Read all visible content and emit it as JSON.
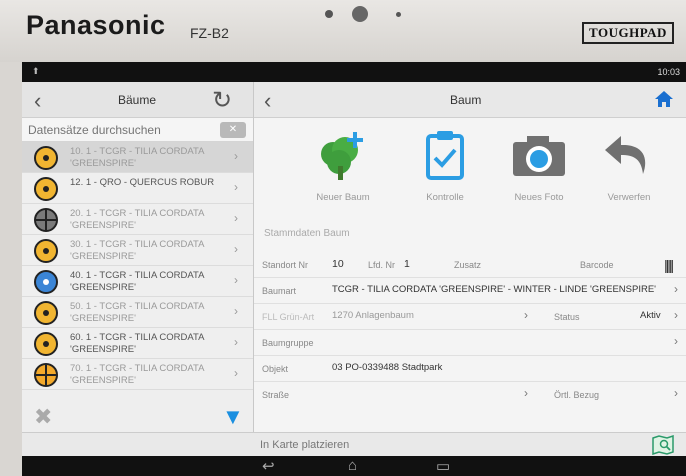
{
  "device": {
    "brand": "Panasonic",
    "model": "FZ-B2",
    "badge": "TOUGHPAD"
  },
  "statusbar": {
    "time": "10:03"
  },
  "left_pane": {
    "title": "Bäume",
    "search_placeholder": "Datensätze durchsuchen",
    "items": [
      {
        "text": "10. 1 - TCGR - TILIA CORDATA 'GREENSPIRE'",
        "marker": "yellow",
        "selected": true
      },
      {
        "text": "12. 1 - QRO - QUERCUS ROBUR",
        "marker": "yellow",
        "selected": false
      },
      {
        "text": "20. 1 - TCGR - TILIA CORDATA 'GREENSPIRE'",
        "marker": "gray",
        "selected": false
      },
      {
        "text": "30. 1 - TCGR - TILIA CORDATA 'GREENSPIRE'",
        "marker": "yellow",
        "selected": false
      },
      {
        "text": "40. 1 - TCGR - TILIA CORDATA 'GREENSPIRE'",
        "marker": "blue",
        "selected": false
      },
      {
        "text": "50. 1 - TCGR - TILIA CORDATA 'GREENSPIRE'",
        "marker": "yellow",
        "selected": false
      },
      {
        "text": "60. 1 - TCGR - TILIA CORDATA 'GREENSPIRE'",
        "marker": "yellow",
        "selected": false
      },
      {
        "text": "70. 1 - TCGR - TILIA CORDATA 'GREENSPIRE'",
        "marker": "orange",
        "selected": false
      }
    ]
  },
  "right_pane": {
    "title": "Baum",
    "actions": {
      "new_tree": "Neuer Baum",
      "control": "Kontrolle",
      "new_photo": "Neues Foto",
      "discard": "Verwerfen"
    },
    "section_title": "Stammdaten Baum",
    "fields": {
      "standort_label": "Standort Nr",
      "standort_value": "10",
      "lfd_label": "Lfd. Nr",
      "lfd_value": "1",
      "zusatz_label": "Zusatz",
      "barcode_label": "Barcode",
      "baumart_label": "Baumart",
      "baumart_value": "TCGR - TILIA CORDATA 'GREENSPIRE' - WINTER - LINDE 'GREENSPIRE'",
      "fll_label": "FLL Grün-Art",
      "fll_value": "1270 Anlagenbaum",
      "status_label": "Status",
      "status_value": "Aktiv",
      "baumgruppe_label": "Baumgruppe",
      "objekt_label": "Objekt",
      "objekt_value": "03 PO-0339488 Stadtpark",
      "strasse_label": "Straße",
      "ortl_label": "Örtl. Bezug"
    }
  },
  "bottom_bar": {
    "place_on_map": "In Karte platzieren"
  },
  "colors": {
    "accent_blue": "#1a8fe0",
    "marker_yellow": "#f1b531",
    "marker_blue": "#3b85d6"
  }
}
